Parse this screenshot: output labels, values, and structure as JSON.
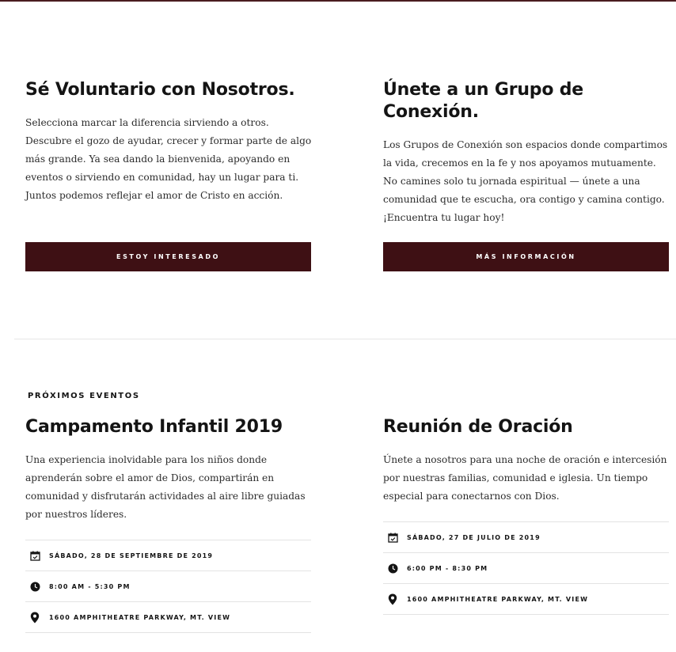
{
  "volunteer": {
    "title": "Sé Voluntario con Nosotros.",
    "body": "Selecciona marcar la diferencia sirviendo a otros. Descubre el gozo de ayudar, crecer y formar parte de algo más grande. Ya sea dando la bienvenida, apoyando en eventos o sirviendo en comunidad, hay un lugar para ti. Juntos podemos reflejar el amor de Cristo en acción.",
    "button_label": "ESTOY INTERESADO"
  },
  "groups": {
    "title": "Únete a un Grupo de Conexión.",
    "body": "Los Grupos de Conexión son espacios donde compartimos la vida, crecemos en la fe y nos apoyamos mutuamente. No camines solo tu jornada espiritual — únete a una comunidad que te escucha, ora contigo y camina contigo. ¡Encuentra tu lugar hoy!",
    "button_label": "MÁS INFORMACIÓN"
  },
  "events": {
    "eyebrow": "PRÓXIMOS EVENTOS",
    "items": [
      {
        "title": "Campamento Infantil 2019",
        "body": "Una experiencia inolvidable para los niños donde aprenderán sobre el amor de Dios, compartirán en comunidad y disfrutarán actividades al aire libre guiadas por nuestros líderes.",
        "date": "SÁBADO, 28 DE SEPTIEMBRE DE 2019",
        "time": "8:00 AM - 5:30 PM",
        "location": "1600 AMPHITHEATRE PARKWAY, MT. VIEW"
      },
      {
        "title": "Reunión de Oración",
        "body": "Únete a nosotros para una noche de oración e intercesión por nuestras familias, comunidad e iglesia. Un tiempo especial para conectarnos con Dios.",
        "date": "SÁBADO, 27 DE JULIO DE 2019",
        "time": "6:00 PM - 8:30 PM",
        "location": "1600 AMPHITHEATRE PARKWAY, MT. VIEW"
      }
    ]
  },
  "colors": {
    "accent": "#3e1014",
    "text": "#141414",
    "divider": "#e3e3e3"
  },
  "icons": {
    "date": "calendar-icon",
    "time": "clock-icon",
    "location": "map-pin-icon"
  }
}
